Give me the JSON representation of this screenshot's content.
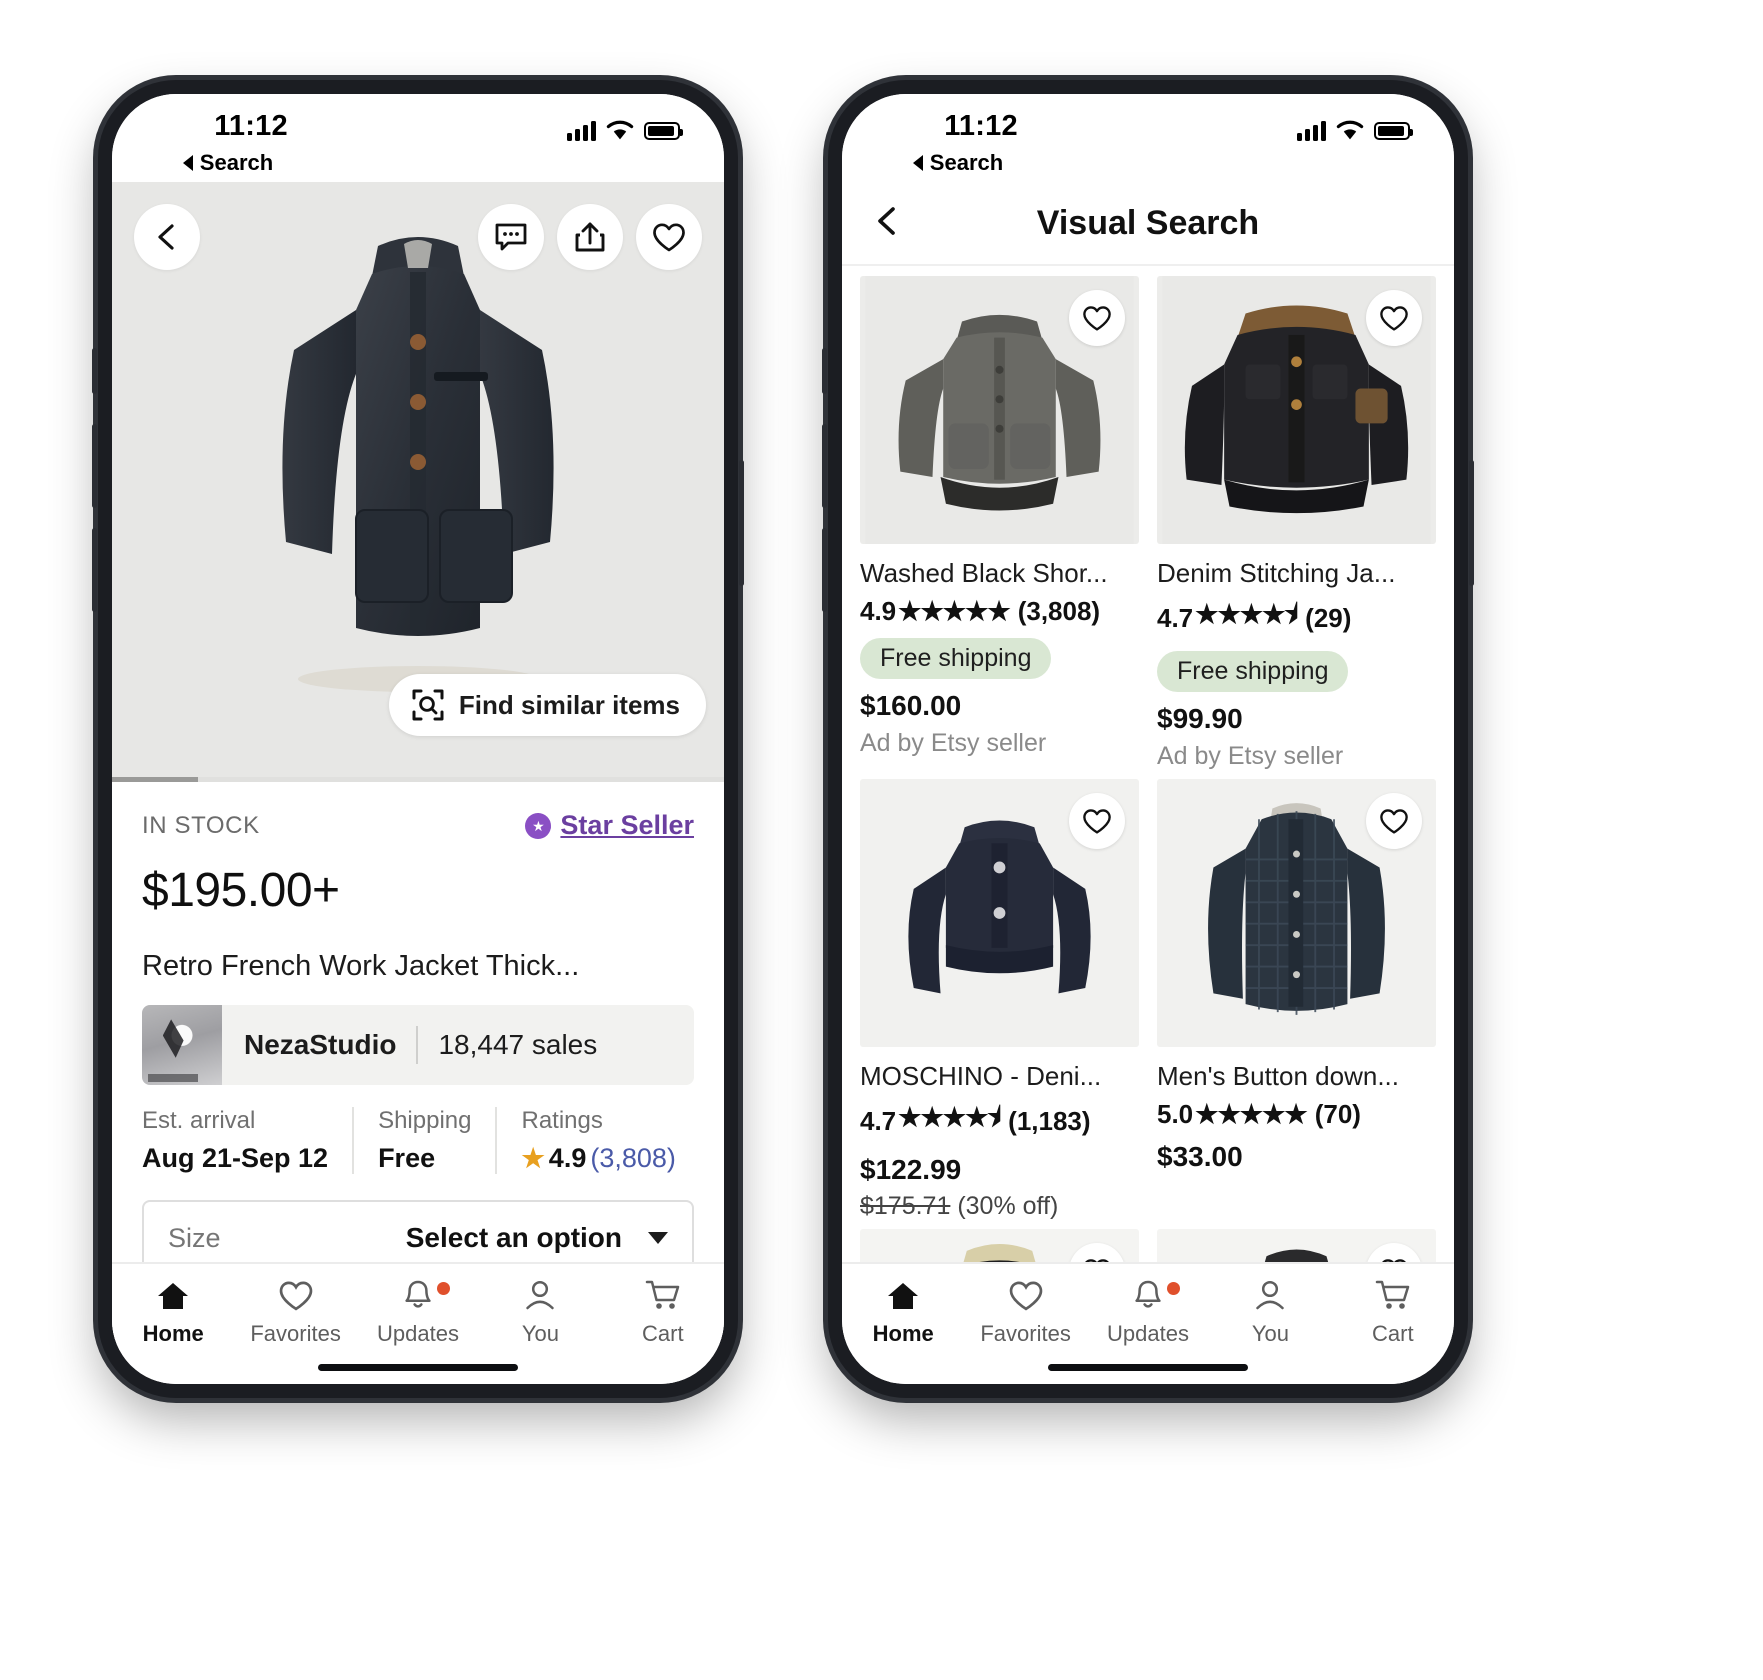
{
  "status_bar": {
    "time": "11:12",
    "back_label": "Search",
    "signal_icon": "cellular-bars-icon",
    "wifi_icon": "wifi-icon",
    "battery_icon": "battery-icon"
  },
  "left_phone": {
    "hero": {
      "back_icon": "chevron-left-icon",
      "message_icon": "message-bubble-icon",
      "share_icon": "share-up-icon",
      "favorite_icon": "heart-outline-icon",
      "find_similar_label": "Find similar items",
      "find_similar_icon": "visual-search-icon",
      "product_image_alt": "dark navy french work jacket"
    },
    "listing": {
      "stock_label": "IN STOCK",
      "star_seller_label": "Star Seller",
      "star_seller_icon": "star-seal-icon",
      "price": "$195.00+",
      "title": "Retro French Work Jacket Thick...",
      "shop_name": "NezaStudio",
      "shop_sales": "18,447 sales",
      "shop_avatar_alt": "NezaStudio shop avatar"
    },
    "facts": [
      {
        "key": "Est. arrival",
        "value": "Aug 21-Sep 12",
        "type": "plain"
      },
      {
        "key": "Shipping",
        "value": "Free",
        "type": "free"
      },
      {
        "key": "Ratings",
        "value": "4.9",
        "count": "(3,808)",
        "star": "★",
        "type": "rating"
      }
    ],
    "size_selector": {
      "label": "Size",
      "value": "Select an option",
      "caret_icon": "chevron-down-icon"
    }
  },
  "right_phone": {
    "header": {
      "title": "Visual Search",
      "back_icon": "chevron-left-icon"
    },
    "results": [
      {
        "title": "Washed Black Shor...",
        "rating": "4.9",
        "stars": "★★★★★",
        "count": "(3,808)",
        "free_shipping": "Free shipping",
        "price": "$160.00",
        "ad_label": "Ad by Etsy seller",
        "favorite_icon": "heart-outline-icon",
        "image_alt": "washed grey chore jacket"
      },
      {
        "title": "Denim Stitching Ja...",
        "rating": "4.7",
        "stars": "★★★★⯨",
        "count": "(29)",
        "free_shipping": "Free shipping",
        "price": "$99.90",
        "ad_label": "Ad by Etsy seller",
        "favorite_icon": "heart-outline-icon",
        "image_alt": "black denim jacket with corduroy collar"
      },
      {
        "title": "MOSCHINO - Deni...",
        "rating": "4.7",
        "stars": "★★★★⯨",
        "count": "(1,183)",
        "free_shipping": "",
        "price": "$122.99",
        "original_price": "$175.71",
        "discount": "(30% off)",
        "ad_label": "",
        "favorite_icon": "heart-outline-icon",
        "image_alt": "navy cropped denim jacket"
      },
      {
        "title": "Men's Button down...",
        "rating": "5.0",
        "stars": "★★★★★",
        "count": "(70)",
        "free_shipping": "",
        "price": "$33.00",
        "ad_label": "",
        "favorite_icon": "heart-outline-icon",
        "image_alt": "dark plaid button down shirt"
      },
      {
        "title": "",
        "rating": "",
        "stars": "",
        "count": "",
        "price": "",
        "favorite_icon": "heart-outline-icon",
        "image_alt": "black double breasted denim jacket"
      },
      {
        "title": "",
        "rating": "",
        "stars": "",
        "count": "",
        "price": "",
        "favorite_icon": "heart-outline-icon",
        "image_alt": "black canvas work jacket"
      }
    ]
  },
  "tabbar": {
    "items": [
      {
        "label": "Home",
        "icon": "home-icon",
        "active": true,
        "badge": false
      },
      {
        "label": "Favorites",
        "icon": "heart-outline-icon",
        "active": false,
        "badge": false
      },
      {
        "label": "Updates",
        "icon": "bell-icon",
        "active": false,
        "badge": true
      },
      {
        "label": "You",
        "icon": "person-icon",
        "active": false,
        "badge": false
      },
      {
        "label": "Cart",
        "icon": "cart-icon",
        "active": false,
        "badge": false
      }
    ]
  },
  "colors": {
    "accent_purple": "#6b3fa0",
    "free_green": "#2e7d4f",
    "pill_green_bg": "#d9e7d3",
    "badge_red": "#e0502c",
    "rating_link_blue": "#4a5aa8"
  }
}
